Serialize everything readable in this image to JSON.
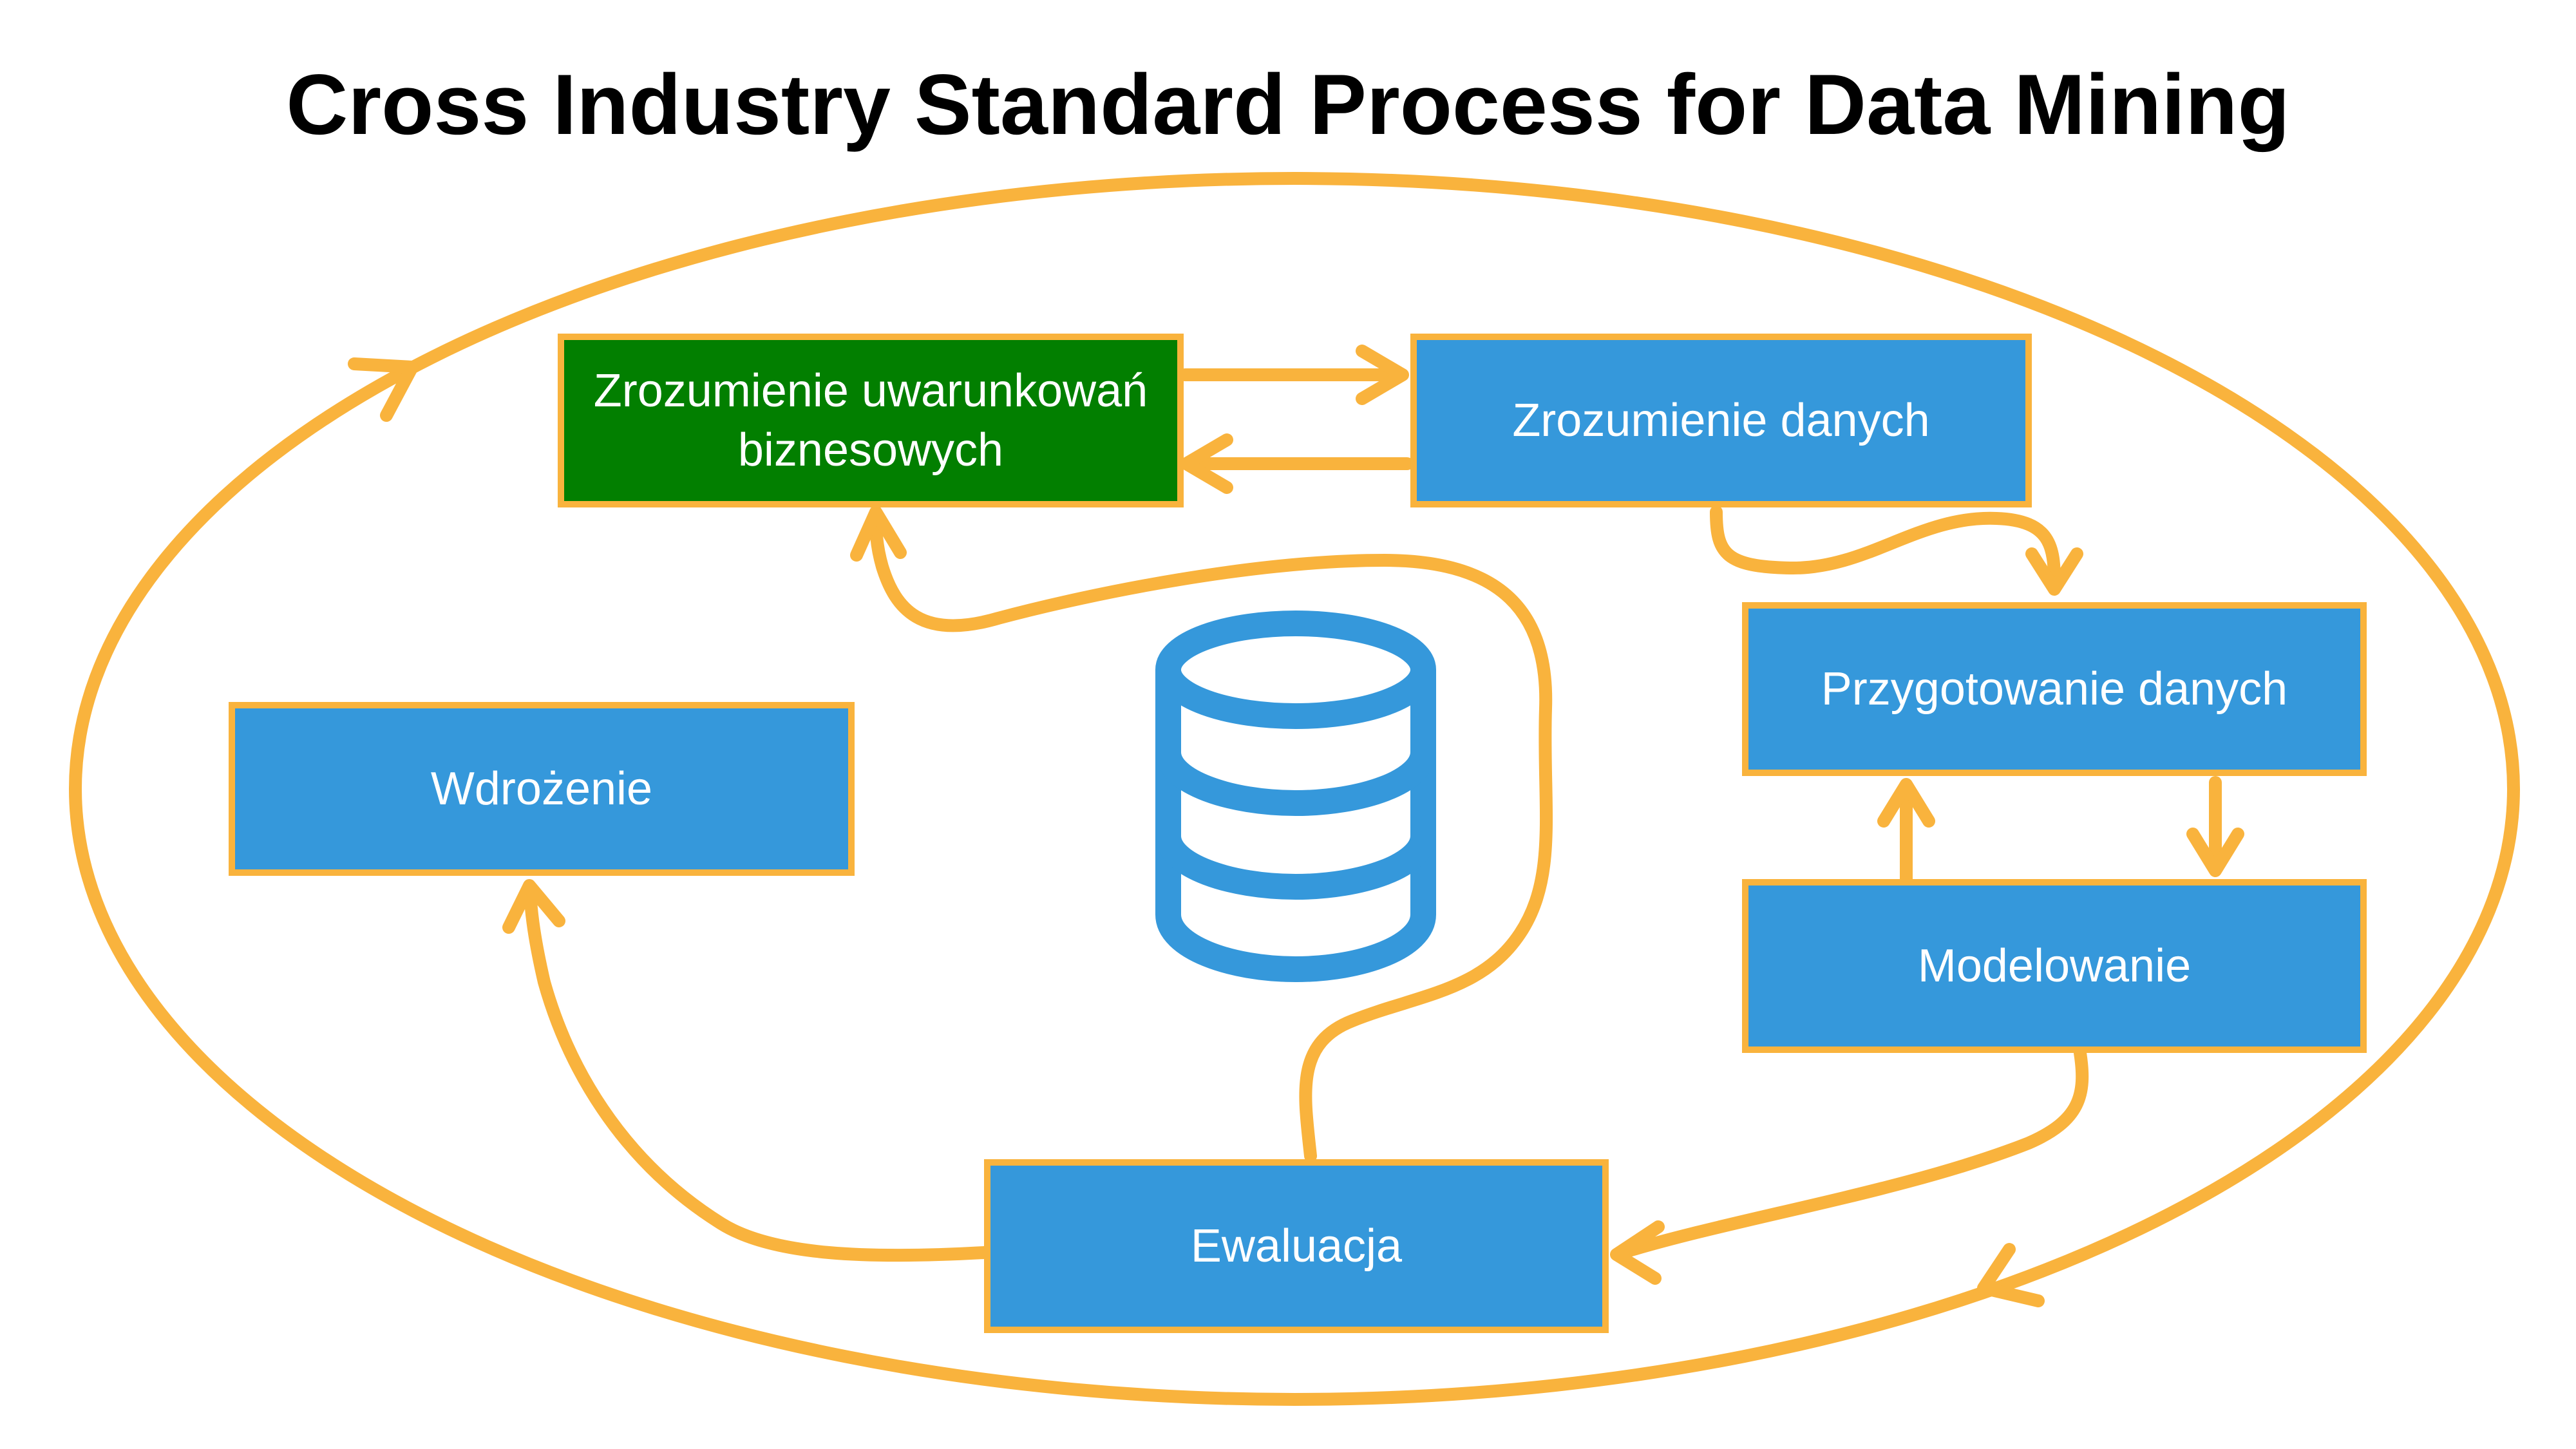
{
  "title": "Cross Industry Standard Process for Data Mining",
  "colors": {
    "box_fill": "#3598DB",
    "highlight_fill": "#027F00",
    "border_arrow": "#F9B33D",
    "icon": "#3598DB",
    "text_on_box": "#FFFFFF"
  },
  "nodes": {
    "business_understanding": "Zrozumienie uwarunkowań biznesowych",
    "data_understanding": "Zrozumienie danych",
    "data_preparation": "Przygotowanie danych",
    "modeling": "Modelowanie",
    "evaluation": "Ewaluacja",
    "deployment": "Wdrożenie"
  },
  "center_icon": "database-icon",
  "cycle": "clockwise"
}
